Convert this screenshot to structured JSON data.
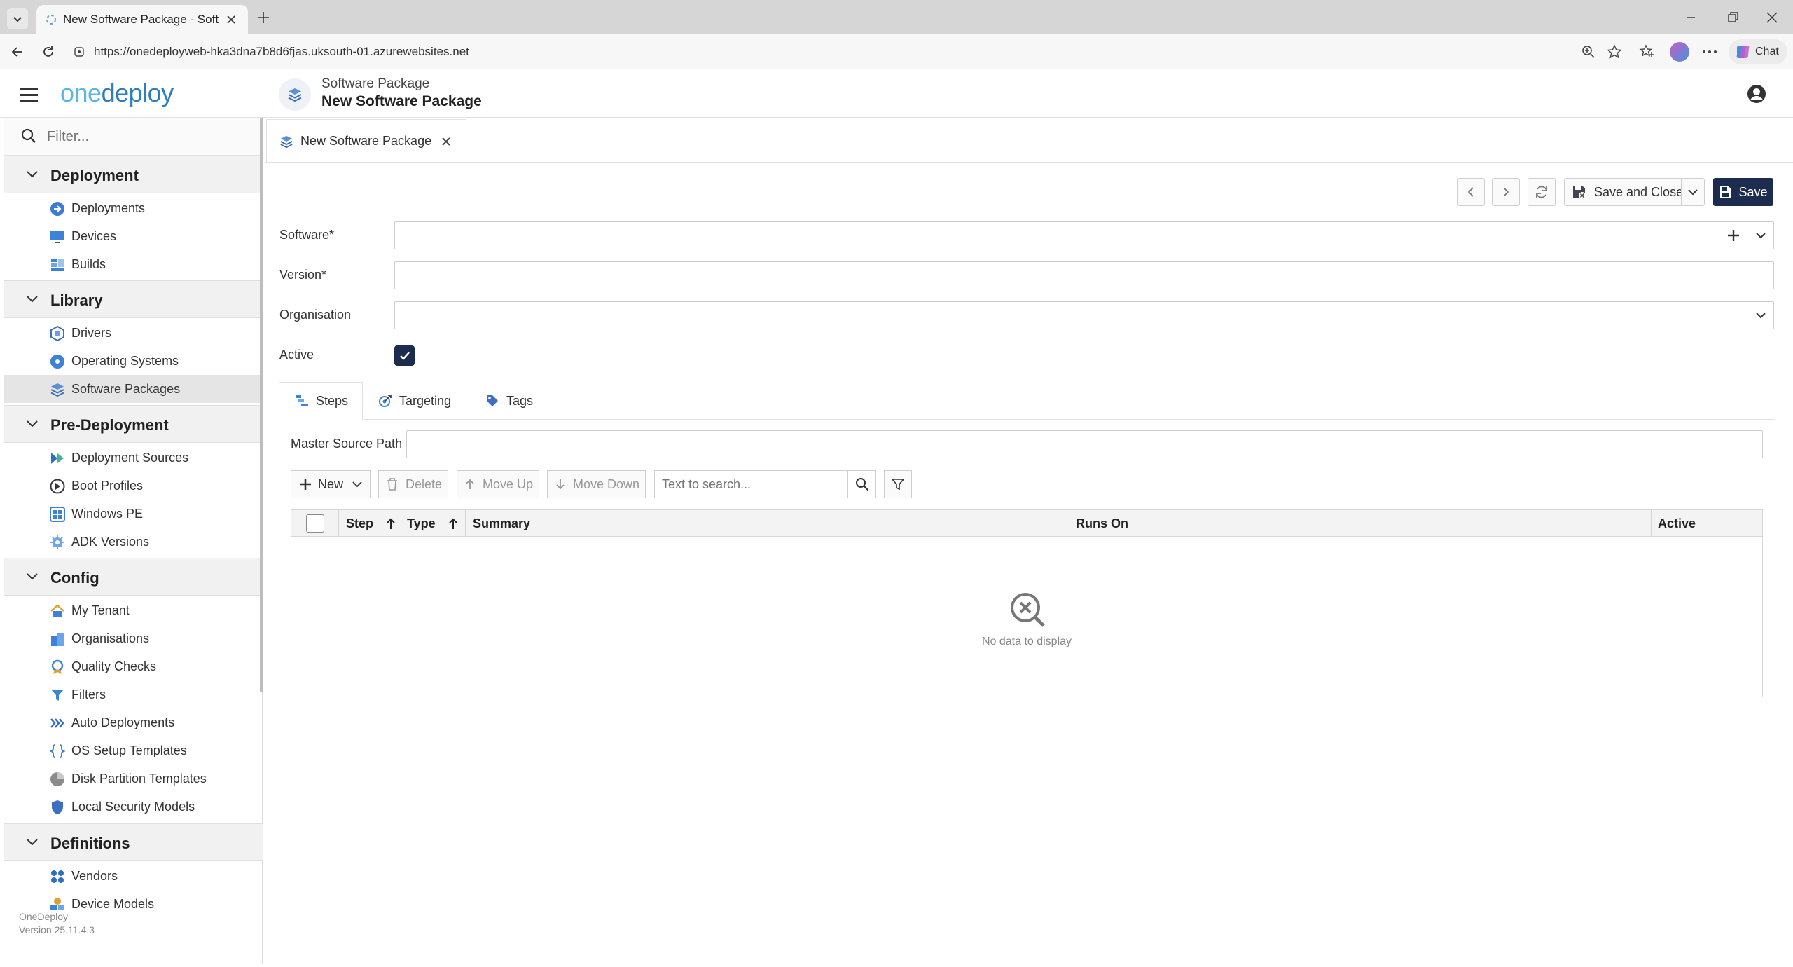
{
  "browser": {
    "tab_title": "New Software Package - Software",
    "url": "https://onedeployweb-hka3dna7b8d6fjas.uksouth-01.azurewebsites.net",
    "chat_label": "Chat"
  },
  "app": {
    "logo_prefix": "one",
    "logo_suffix": "deploy",
    "breadcrumb_parent": "Software Package",
    "page_title": "New Software Package"
  },
  "sidebar": {
    "filter_placeholder": "Filter...",
    "sections": [
      {
        "label": "Deployment",
        "items": [
          "Deployments",
          "Devices",
          "Builds"
        ]
      },
      {
        "label": "Library",
        "items": [
          "Drivers",
          "Operating Systems",
          "Software Packages"
        ]
      },
      {
        "label": "Pre-Deployment",
        "items": [
          "Deployment Sources",
          "Boot Profiles",
          "Windows PE",
          "ADK Versions"
        ]
      },
      {
        "label": "Config",
        "items": [
          "My Tenant",
          "Organisations",
          "Quality Checks",
          "Filters",
          "Auto Deployments",
          "OS Setup Templates",
          "Disk Partition Templates",
          "Local Security Models"
        ]
      },
      {
        "label": "Definitions",
        "items": [
          "Vendors",
          "Device Models"
        ]
      }
    ],
    "footer_name": "OneDeploy",
    "footer_version": "Version 25.11.4.3"
  },
  "doc_tab": {
    "label": "New Software Package"
  },
  "toolbar": {
    "save_close_label": "Save and Close",
    "save_label": "Save"
  },
  "form": {
    "software_label": "Software*",
    "software_value": "",
    "version_label": "Version*",
    "version_value": "",
    "organisation_label": "Organisation",
    "organisation_value": "",
    "active_label": "Active",
    "active_checked": true
  },
  "subtabs": [
    "Steps",
    "Targeting",
    "Tags"
  ],
  "steps": {
    "master_source_label": "Master Source Path",
    "master_source_value": "",
    "new_label": "New",
    "delete_label": "Delete",
    "move_up_label": "Move Up",
    "move_down_label": "Move Down",
    "search_placeholder": "Text to search...",
    "columns": [
      "Step",
      "Type",
      "Summary",
      "Runs On",
      "Active"
    ],
    "empty_text": "No data to display"
  }
}
